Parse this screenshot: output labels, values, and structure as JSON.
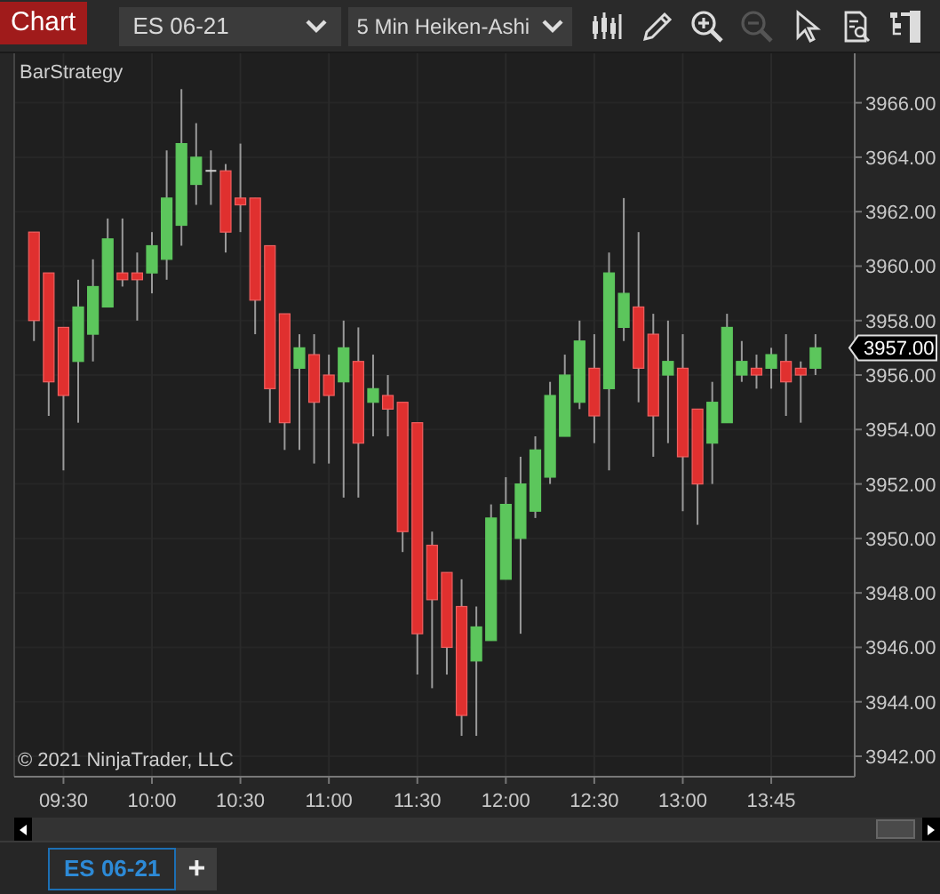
{
  "toolbar": {
    "chart_button": "Chart",
    "instrument": "ES 06-21",
    "interval": "5 Min Heiken-Ashi",
    "tools": [
      {
        "disabled": false
      },
      {
        "disabled": false
      },
      {
        "disabled": false
      },
      {
        "disabled": true
      },
      {
        "disabled": false
      },
      {
        "disabled": false
      },
      {
        "disabled": false
      }
    ]
  },
  "strategy_label": "BarStrategy",
  "copyright": "© 2021 NinjaTrader, LLC",
  "chart": {
    "chart_data": {
      "type": "candlestick",
      "categories": [
        null,
        null,
        "09:30",
        null,
        null,
        null,
        null,
        null,
        "10:00",
        null,
        null,
        null,
        null,
        null,
        "10:30",
        null,
        null,
        null,
        null,
        null,
        "11:00",
        null,
        null,
        null,
        null,
        null,
        "11:30",
        null,
        null,
        null,
        null,
        null,
        "12:00",
        null,
        null,
        null,
        null,
        null,
        "12:30",
        null,
        null,
        null,
        null,
        null,
        "13:00",
        null,
        null,
        null,
        null,
        null,
        "13:45",
        null,
        null,
        null
      ],
      "ylim": [
        3941.25,
        3967.75
      ],
      "grid": true,
      "yticks": [
        {
          "value": 3942,
          "label": "3942.00"
        },
        {
          "value": 3944,
          "label": "3944.00"
        },
        {
          "value": 3946,
          "label": "3946.00"
        },
        {
          "value": 3948,
          "label": "3948.00"
        },
        {
          "value": 3950,
          "label": "3950.00"
        },
        {
          "value": 3952,
          "label": "3952.00"
        },
        {
          "value": 3954,
          "label": "3954.00"
        },
        {
          "value": 3956,
          "label": "3956.00"
        },
        {
          "value": 3958,
          "label": "3958.00"
        },
        {
          "value": 3960,
          "label": "3960.00"
        },
        {
          "value": 3962,
          "label": "3962.00"
        },
        {
          "value": 3964,
          "label": "3964.00"
        },
        {
          "value": 3966,
          "label": "3966.00"
        }
      ],
      "ohlc": [
        [
          3961.25,
          3961.25,
          3957.25,
          3958
        ],
        [
          3959.75,
          3959.75,
          3954.5,
          3955.75
        ],
        [
          3957.75,
          3957.75,
          3952.5,
          3955.25
        ],
        [
          3956.5,
          3959.5,
          3954.25,
          3958.5
        ],
        [
          3957.5,
          3960.25,
          3956.5,
          3959.25
        ],
        [
          3958.5,
          3961.75,
          3958.5,
          3961
        ],
        [
          3959.75,
          3961.75,
          3959.25,
          3959.5
        ],
        [
          3959.75,
          3960.5,
          3958,
          3959.5
        ],
        [
          3959.75,
          3961.25,
          3959,
          3960.75
        ],
        [
          3960.25,
          3964.25,
          3959.5,
          3962.5
        ],
        [
          3961.5,
          3966.5,
          3960.75,
          3964.5
        ],
        [
          3963,
          3965.25,
          3962.25,
          3964
        ],
        [
          3963.5,
          3964.25,
          3962.25,
          3963.5
        ],
        [
          3963.5,
          3963.75,
          3960.5,
          3961.25
        ],
        [
          3962.5,
          3964.5,
          3961.25,
          3962.25
        ],
        [
          3962.5,
          3962.5,
          3957.5,
          3958.75
        ],
        [
          3960.75,
          3960.75,
          3954.25,
          3955.5
        ],
        [
          3958.25,
          3958.25,
          3953.25,
          3954.25
        ],
        [
          3956.25,
          3957.5,
          3953.25,
          3957
        ],
        [
          3956.75,
          3957.5,
          3952.75,
          3955
        ],
        [
          3956,
          3956.75,
          3952.75,
          3955.25
        ],
        [
          3955.75,
          3958,
          3951.5,
          3957
        ],
        [
          3956.5,
          3957.75,
          3951.5,
          3953.5
        ],
        [
          3955,
          3956.75,
          3953.75,
          3955.5
        ],
        [
          3955.25,
          3956,
          3953.75,
          3954.75
        ],
        [
          3955,
          3955,
          3949.5,
          3950.25
        ],
        [
          3954.25,
          3954.25,
          3945,
          3946.5
        ],
        [
          3949.75,
          3950.25,
          3944.5,
          3947.75
        ],
        [
          3948.75,
          3948.75,
          3945,
          3946
        ],
        [
          3947.5,
          3948.5,
          3942.75,
          3943.5
        ],
        [
          3945.5,
          3947.5,
          3942.75,
          3946.75
        ],
        [
          3946.25,
          3951.25,
          3946.25,
          3950.75
        ],
        [
          3948.5,
          3952.25,
          3948.5,
          3951.25
        ],
        [
          3950,
          3953,
          3946.5,
          3952
        ],
        [
          3951,
          3953.75,
          3950.75,
          3953.25
        ],
        [
          3952.25,
          3955.75,
          3952,
          3955.25
        ],
        [
          3953.75,
          3956.75,
          3953.75,
          3956
        ],
        [
          3955,
          3958,
          3954.75,
          3957.25
        ],
        [
          3956.25,
          3957.5,
          3953.5,
          3954.5
        ],
        [
          3955.5,
          3960.5,
          3952.5,
          3959.75
        ],
        [
          3957.75,
          3962.5,
          3957.25,
          3959
        ],
        [
          3958.5,
          3961.25,
          3955,
          3956.25
        ],
        [
          3957.5,
          3958.25,
          3953,
          3954.5
        ],
        [
          3956,
          3958,
          3953.5,
          3956.5
        ],
        [
          3956.25,
          3957.5,
          3951,
          3953
        ],
        [
          3954.75,
          3954.75,
          3950.5,
          3952
        ],
        [
          3953.5,
          3955.75,
          3952,
          3955
        ],
        [
          3954.25,
          3958.25,
          3954.25,
          3957.75
        ],
        [
          3956,
          3957.25,
          3955.75,
          3956.5
        ],
        [
          3956.25,
          3956.75,
          3955.5,
          3956
        ],
        [
          3956.25,
          3957,
          3955.5,
          3956.75
        ],
        [
          3956.5,
          3957.5,
          3954.5,
          3955.75
        ],
        [
          3956.25,
          3956.5,
          3954.25,
          3956
        ],
        [
          3956.25,
          3957.5,
          3956,
          3957
        ]
      ],
      "annotations": [
        "3957.00"
      ]
    }
  },
  "tabs": [
    {
      "label": "ES 06-21",
      "selected": true
    }
  ],
  "add_tab": "+"
}
